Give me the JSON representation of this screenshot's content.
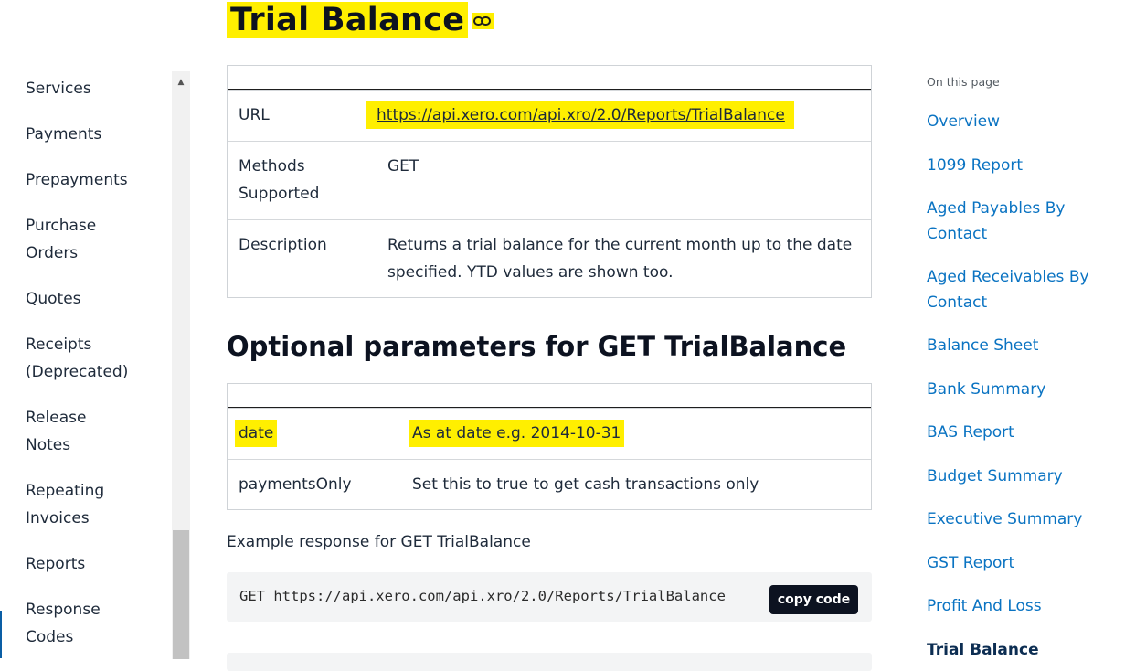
{
  "sidebar": {
    "items": [
      {
        "lines": [
          "Services"
        ]
      },
      {
        "lines": [
          "Payments"
        ]
      },
      {
        "lines": [
          "Prepayments"
        ]
      },
      {
        "lines": [
          "Purchase",
          "Orders"
        ]
      },
      {
        "lines": [
          "Quotes"
        ]
      },
      {
        "lines": [
          "Receipts",
          "(Deprecated)"
        ]
      },
      {
        "lines": [
          "Release",
          "Notes"
        ]
      },
      {
        "lines": [
          "Repeating",
          "Invoices"
        ]
      },
      {
        "lines": [
          "Reports"
        ]
      },
      {
        "lines": [
          "Response",
          "Codes"
        ]
      }
    ],
    "active": "Reports"
  },
  "page": {
    "title": "Trial Balance",
    "endpoint_table": {
      "url_label": "URL",
      "url_value": "https://api.xero.com/api.xro/2.0/Reports/TrialBalance",
      "methods_label_1": "Methods",
      "methods_label_2": "Supported",
      "methods_value": "GET",
      "description_label": "Description",
      "description_line_1": "Returns a trial balance for the current month up to the date",
      "description_line_2": "specified. YTD values are shown too."
    },
    "params_heading": "Optional parameters for GET TrialBalance",
    "params": [
      {
        "name": "date",
        "description": "As at date e.g. 2014-10-31"
      },
      {
        "name": "paymentsOnly",
        "description": "Set this to true to get cash transactions only"
      }
    ],
    "example_label": "Example response for GET TrialBalance",
    "example_code": "GET https://api.xero.com/api.xro/2.0/Reports/TrialBalance",
    "copy_button": "copy code"
  },
  "toc": {
    "title": "On this page",
    "items": [
      {
        "lines": [
          "Overview"
        ]
      },
      {
        "lines": [
          "1099 Report"
        ]
      },
      {
        "lines": [
          "Aged Payables By",
          "Contact"
        ]
      },
      {
        "lines": [
          "Aged Receivables By",
          "Contact"
        ]
      },
      {
        "lines": [
          "Balance Sheet"
        ]
      },
      {
        "lines": [
          "Bank Summary"
        ]
      },
      {
        "lines": [
          "BAS Report"
        ]
      },
      {
        "lines": [
          "Budget Summary"
        ]
      },
      {
        "lines": [
          "Executive Summary"
        ]
      },
      {
        "lines": [
          "GST Report"
        ]
      },
      {
        "lines": [
          "Profit And Loss"
        ]
      },
      {
        "lines": [
          "Trial Balance"
        ]
      }
    ],
    "active": "Trial Balance"
  },
  "colors": {
    "highlight": "#ffef00",
    "link": "#0a73c2",
    "heading": "#0c1220",
    "code_bg": "#f3f4f5"
  }
}
